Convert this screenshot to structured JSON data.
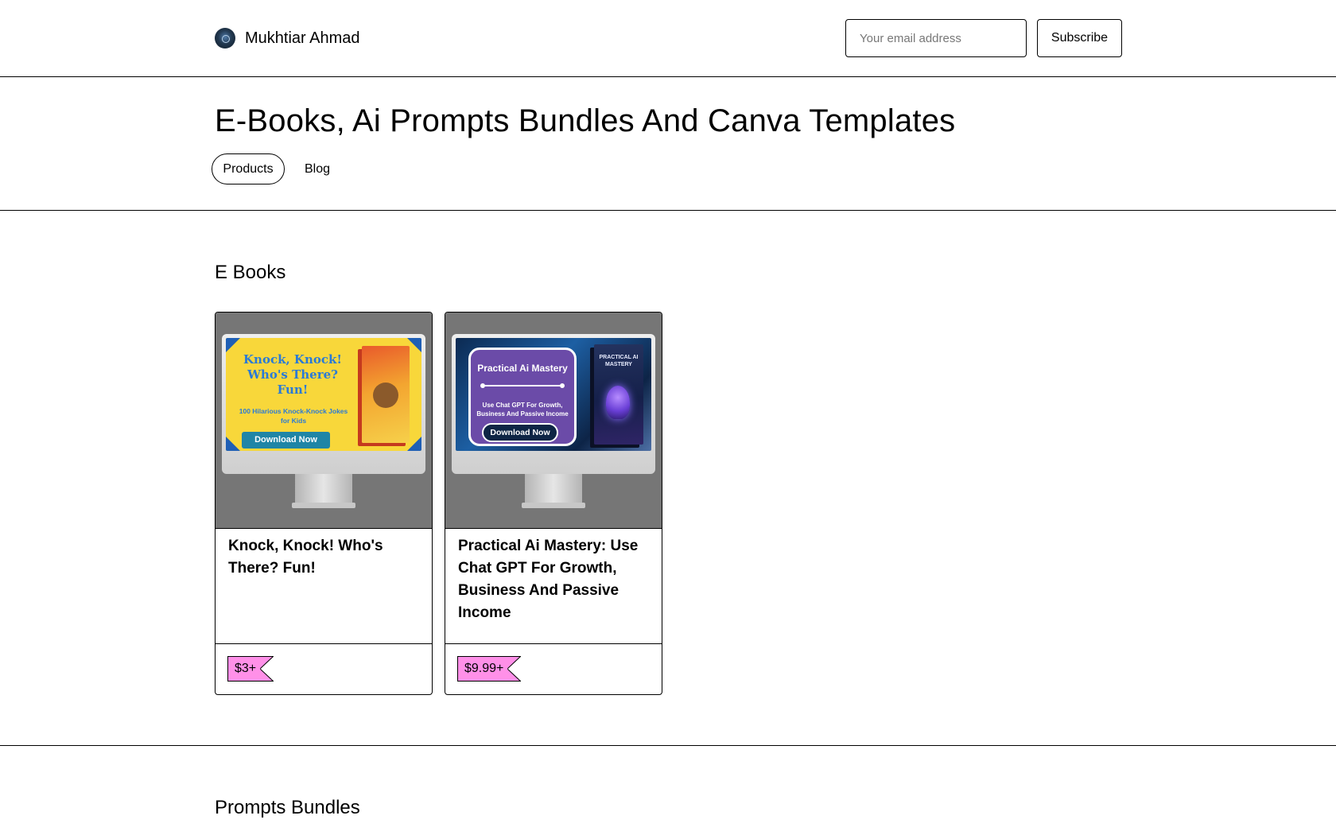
{
  "header": {
    "brand_name": "Mukhtiar Ahmad",
    "email_placeholder": "Your email address",
    "subscribe_label": "Subscribe"
  },
  "store": {
    "title": "E-Books, Ai Prompts Bundles And Canva Templates",
    "tabs": [
      {
        "label": "Products",
        "active": true
      },
      {
        "label": "Blog",
        "active": false
      }
    ]
  },
  "sections": [
    {
      "title": "E Books",
      "products": [
        {
          "title": "Knock, Knock! Who's There? Fun!",
          "price": "$3+",
          "thumbnail": {
            "headline": "Knock, Knock! Who's There? Fun!",
            "subline": "100 Hilarious Knock-Knock Jokes for Kids",
            "button": "Download Now",
            "book_cover": "Knock Knock Who's There? Fun"
          }
        },
        {
          "title": "Practical Ai Mastery: Use Chat GPT For Growth, Business And Passive Income",
          "price": "$9.99+",
          "thumbnail": {
            "headline": "Practical Ai Mastery",
            "subline": "Use Chat GPT For Growth, Business And Passive Income",
            "button": "Download Now",
            "book_cover": "PRACTICAL AI MASTERY"
          }
        }
      ]
    },
    {
      "title": "Prompts Bundles",
      "products": []
    }
  ],
  "colors": {
    "price_tag": "#ff90e8",
    "thumbnail_bg": "#767676",
    "border": "#000000"
  }
}
